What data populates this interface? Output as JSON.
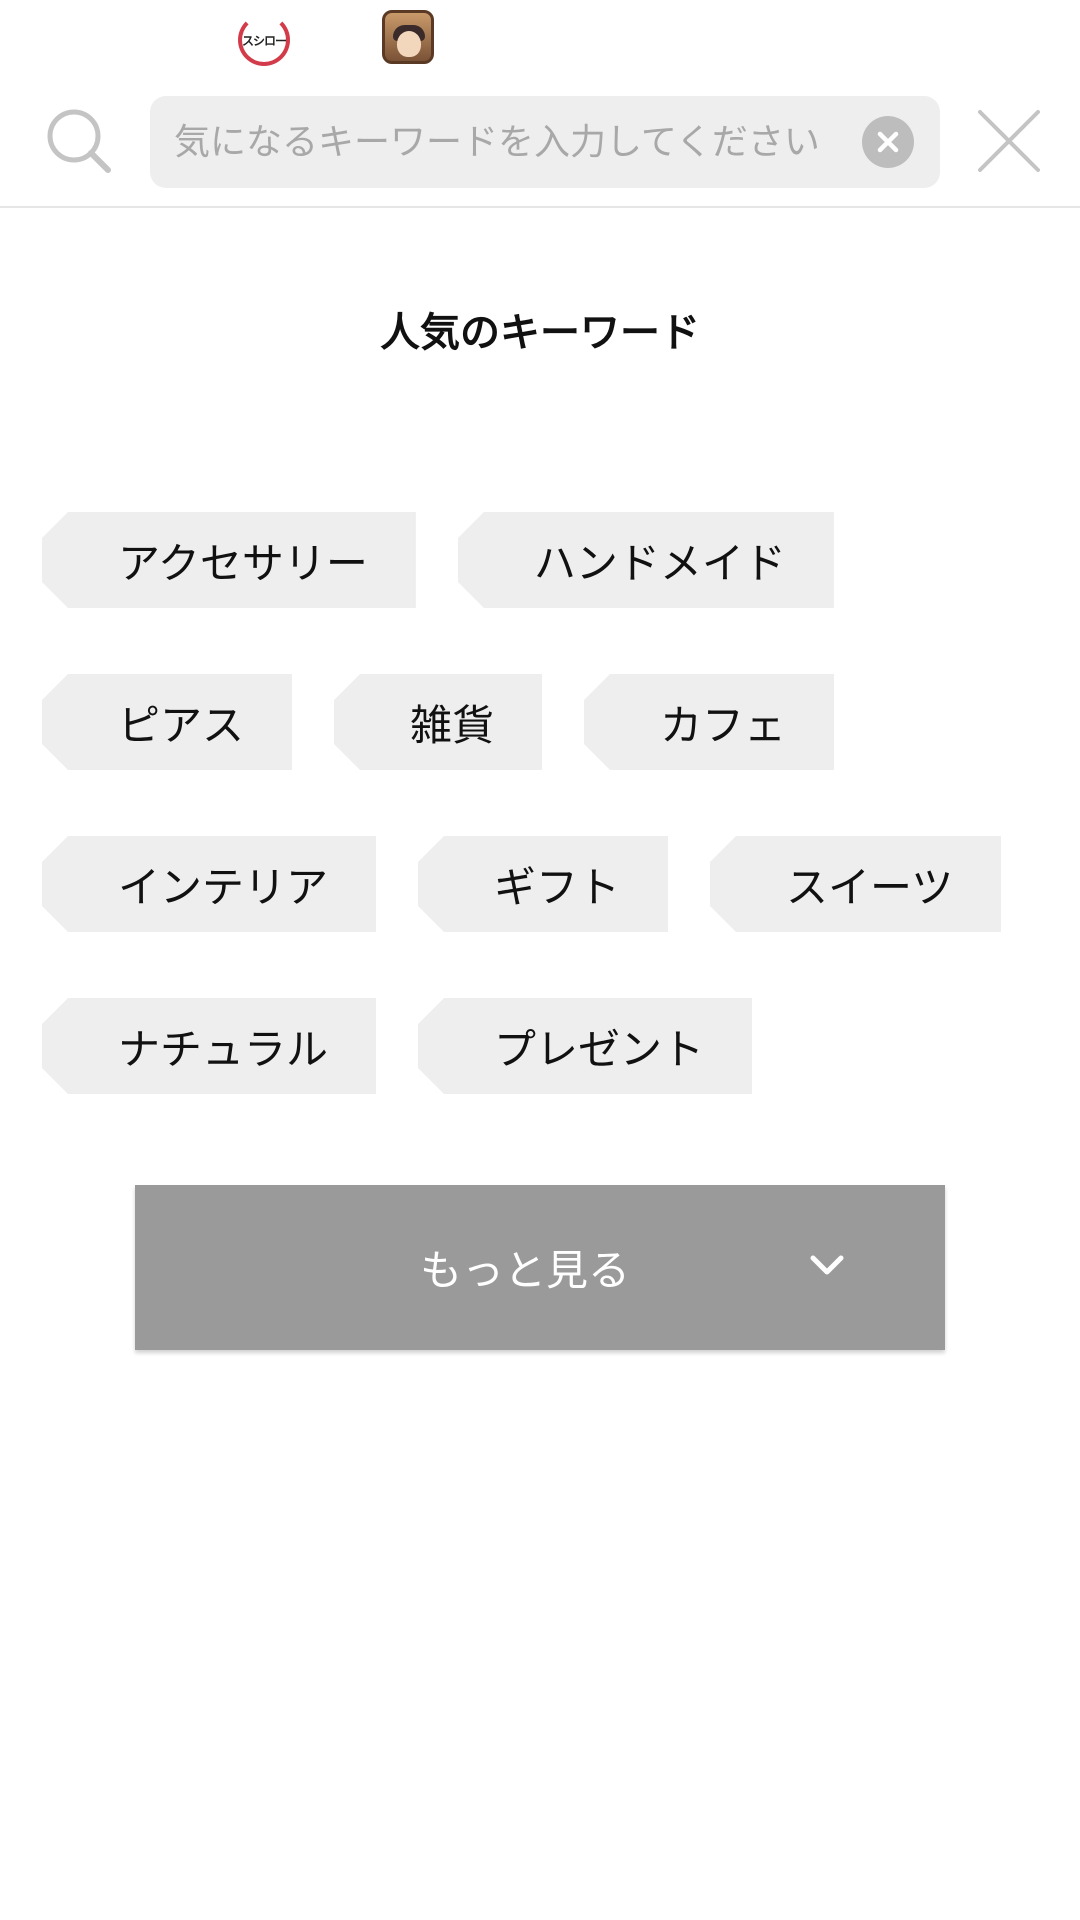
{
  "status_bar": {
    "app_icons": [
      {
        "name": "sushiro-app-icon",
        "text": "スシロー"
      },
      {
        "name": "game-app-icon"
      }
    ]
  },
  "search": {
    "placeholder": "気になるキーワードを入力してください",
    "value": ""
  },
  "popular": {
    "title": "人気のキーワード",
    "rows": [
      [
        "アクセサリー",
        "ハンドメイド"
      ],
      [
        "ピアス",
        "雑貨",
        "カフェ"
      ],
      [
        "インテリア",
        "ギフト",
        "スイーツ"
      ],
      [
        "ナチュラル",
        "プレゼント"
      ]
    ]
  },
  "more_button": {
    "label": "もっと見る"
  },
  "colors": {
    "tag_bg": "#eeeeee",
    "more_button_bg": "#9a9a9a",
    "search_bg": "#eeeeee",
    "icon_gray": "#c4c4c4"
  },
  "icons": {
    "search": "search-icon",
    "clear": "clear-circle-icon",
    "close": "close-icon",
    "more": "chevron-down-icon"
  }
}
